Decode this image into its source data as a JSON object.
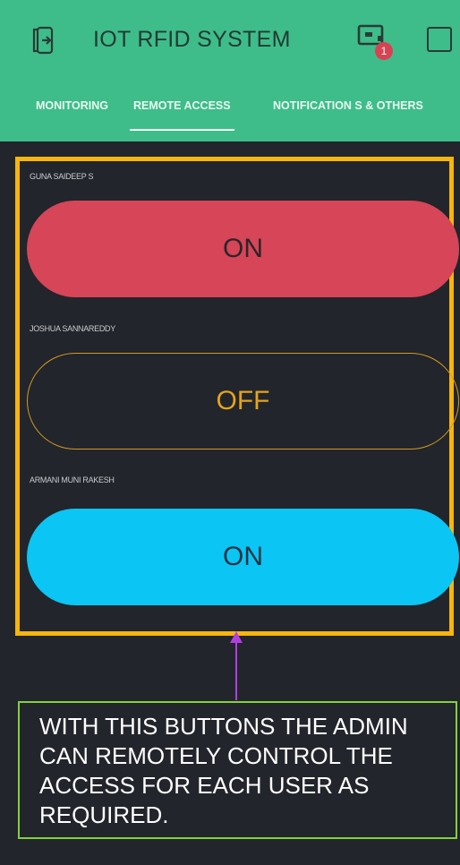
{
  "header": {
    "title": "IOT RFID SYSTEM",
    "device_badge": "1",
    "back_icon": "logout-icon",
    "device_icon": "devices-icon",
    "colors": {
      "header_bg": "#3ebd8a",
      "badge": "#d84354"
    }
  },
  "tabs": [
    {
      "label": "MONITORING"
    },
    {
      "label": "REMOTE ACCESS",
      "active": true
    },
    {
      "label": "NOTIFICATION S & OTHERS"
    }
  ],
  "switches": [
    {
      "user": "GUNA SAIDEEP S",
      "state": "ON",
      "color": "#d64558"
    },
    {
      "user": "JOSHUA SANNAREDDY",
      "state": "OFF",
      "color": "#e3a41e"
    },
    {
      "user": "ARMANI MUNI RAKESH",
      "state": "ON",
      "color": "#0bc5f4"
    }
  ],
  "annotation": {
    "lines": [
      "WITH THIS BUTTONS THE ADMIN",
      "CAN REMOTELY CONTROL THE",
      "ACCESS FOR EACH USER AS",
      "REQUIRED."
    ],
    "frame_color": "#f6b60e",
    "note_border_color": "#83d13c",
    "arrow_color": "#b13fe0"
  }
}
